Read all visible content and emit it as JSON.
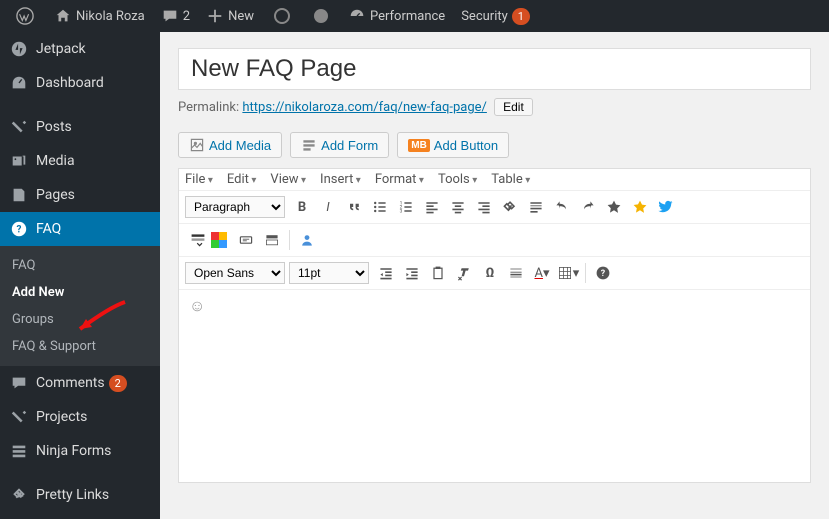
{
  "topbar": {
    "site_name": "Nikola Roza",
    "comments_count": "2",
    "new_label": "New",
    "performance_label": "Performance",
    "security_label": "Security",
    "security_count": "1"
  },
  "sidebar": {
    "jetpack": "Jetpack",
    "dashboard": "Dashboard",
    "posts": "Posts",
    "media": "Media",
    "pages": "Pages",
    "faq": "FAQ",
    "faq_sub": {
      "list": "FAQ",
      "add_new": "Add New",
      "groups": "Groups",
      "support": "FAQ & Support"
    },
    "comments": "Comments",
    "comments_count": "2",
    "projects": "Projects",
    "ninja": "Ninja Forms",
    "pretty": "Pretty Links"
  },
  "editor": {
    "title": "New FAQ Page",
    "permalink_label": "Permalink:",
    "permalink_url_base": "https://nikolaroza.com/faq/",
    "permalink_slug": "new-faq-page/",
    "edit_btn": "Edit",
    "add_media": "Add Media",
    "add_form": "Add Form",
    "add_button": "Add Button",
    "mb_badge": "MB",
    "menubar": {
      "file": "File",
      "edit": "Edit",
      "view": "View",
      "insert": "Insert",
      "format": "Format",
      "tools": "Tools",
      "table": "Table"
    },
    "format_select": "Paragraph",
    "font_select": "Open Sans",
    "size_select": "11pt"
  }
}
